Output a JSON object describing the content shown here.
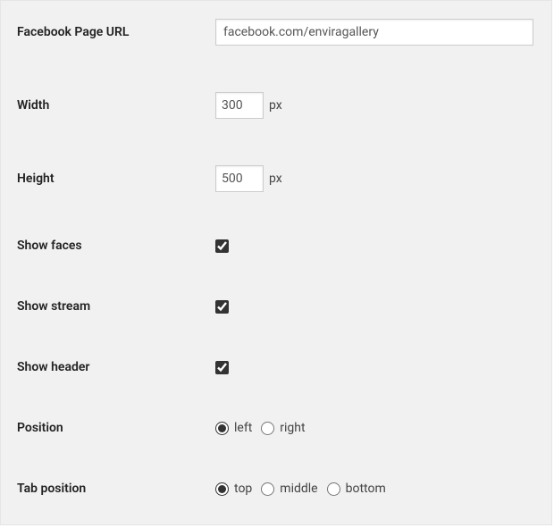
{
  "fields": {
    "page_url": {
      "label": "Facebook Page URL",
      "value": "facebook.com/enviragallery"
    },
    "width": {
      "label": "Width",
      "value": "300",
      "unit": "px"
    },
    "height": {
      "label": "Height",
      "value": "500",
      "unit": "px"
    },
    "show_faces": {
      "label": "Show faces",
      "checked": true
    },
    "show_stream": {
      "label": "Show stream",
      "checked": true
    },
    "show_header": {
      "label": "Show header",
      "checked": true
    },
    "position": {
      "label": "Position",
      "options": [
        "left",
        "right"
      ],
      "selected": "left"
    },
    "tab_position": {
      "label": "Tab position",
      "options": [
        "top",
        "middle",
        "bottom"
      ],
      "selected": "top"
    }
  }
}
